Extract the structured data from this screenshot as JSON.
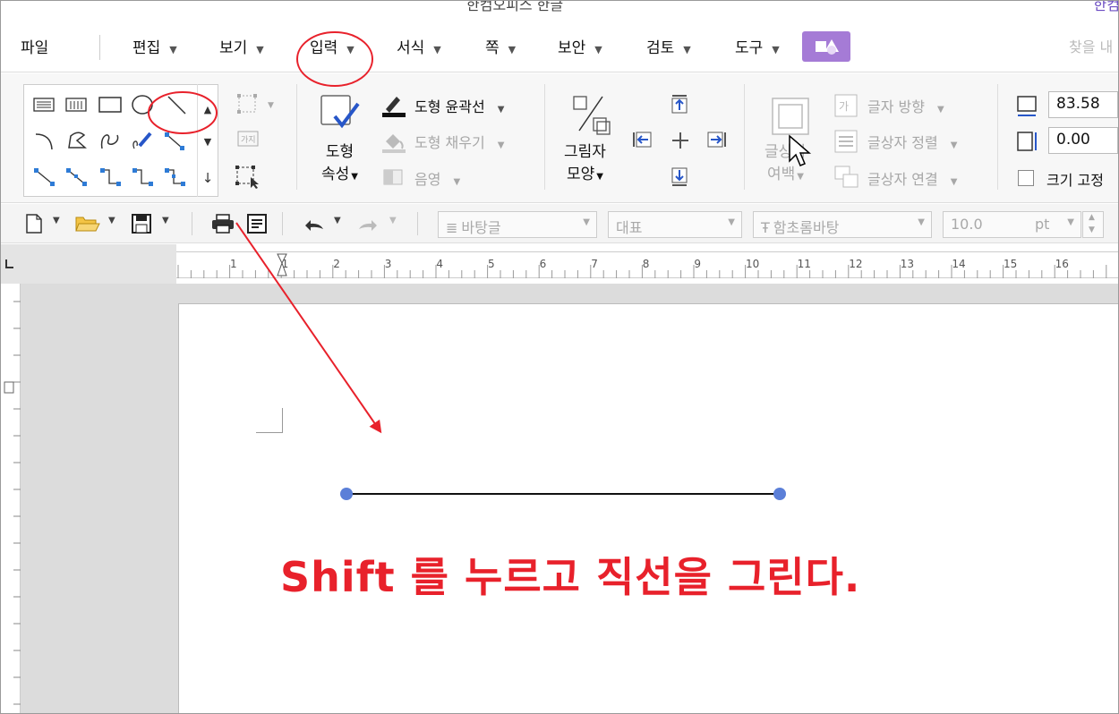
{
  "titlebar": {
    "title": "한컴오피스 한글",
    "right_text": "한컴"
  },
  "menu": {
    "items": [
      {
        "id": "file",
        "label": "파일",
        "caret": false
      },
      {
        "id": "edit",
        "label": "편집",
        "caret": true
      },
      {
        "id": "view",
        "label": "보기",
        "caret": true
      },
      {
        "id": "insert",
        "label": "입력",
        "caret": true
      },
      {
        "id": "format",
        "label": "서식",
        "caret": true
      },
      {
        "id": "page",
        "label": "쪽",
        "caret": true
      },
      {
        "id": "security",
        "label": "보안",
        "caret": true
      },
      {
        "id": "review",
        "label": "검토",
        "caret": true
      },
      {
        "id": "tools",
        "label": "도구",
        "caret": true
      }
    ],
    "search_placeholder": "찾을 내"
  },
  "ribbon": {
    "shape_props_label_1": "도형",
    "shape_props_label_2": "속성",
    "outline_label": "도형 윤곽선",
    "fill_label": "도형 채우기",
    "shadow_label": "음영",
    "shadow_shape_label_1": "그림자",
    "shadow_shape_label_2": "모양",
    "textbox_margin_label_1": "글상자",
    "textbox_margin_label_2": "여백",
    "text_direction_label": "글자 방향",
    "text_align_label": "글상자 정렬",
    "text_link_label": "글상자 연결",
    "width_value": "83.58",
    "height_value": "0.00",
    "fix_size_label": "크기 고정"
  },
  "toolbar": {
    "style_value": "바탕글",
    "lang_value": "대표",
    "font_value": "함초롬바탕",
    "size_value": "10.0",
    "unit_value": "pt"
  },
  "ruler": {
    "h_labels": [
      "1",
      "1",
      "2",
      "3",
      "4",
      "5",
      "6",
      "7",
      "8",
      "9",
      "10",
      "11",
      "12",
      "13",
      "14",
      "15",
      "16"
    ]
  },
  "document": {
    "instruction": "Shift 를 누르고 직선을 그린다."
  },
  "colors": {
    "annotation_red": "#e8212b",
    "accent_purple": "#a57bd6",
    "handle_blue": "#5b7fd8"
  }
}
